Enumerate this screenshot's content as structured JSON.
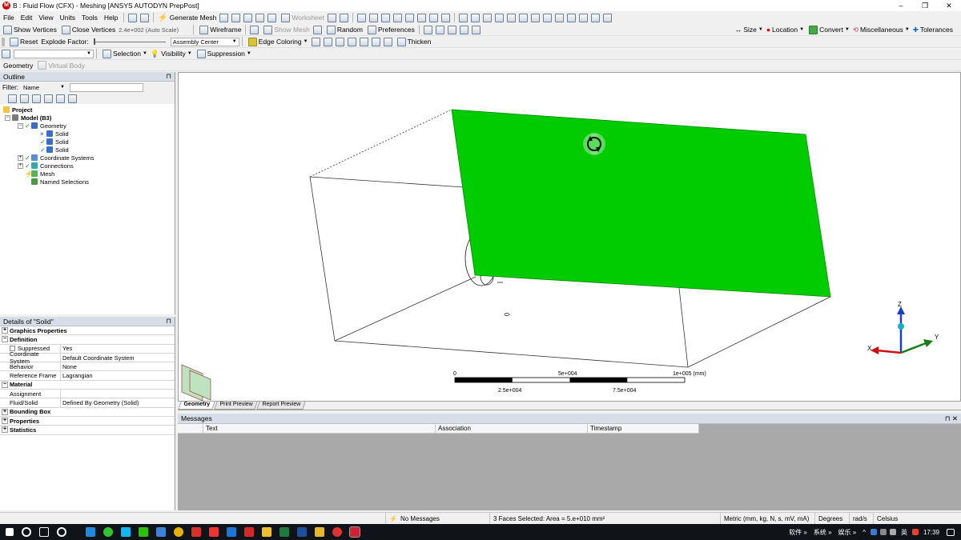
{
  "window": {
    "title": "B : Fluid Flow (CFX) - Meshing [ANSYS AUTODYN PrepPost]",
    "minimize": "–",
    "maximize": "❐",
    "close": "✕"
  },
  "menu": [
    "File",
    "Edit",
    "View",
    "Units",
    "Tools",
    "Help"
  ],
  "toolbar1": {
    "generate_mesh": "Generate Mesh",
    "show_mesh": "Show Mesh",
    "worksheet": "Worksheet"
  },
  "toolbar2": {
    "show_vertices": "Show Vertices",
    "close_vertices": "Close Vertices",
    "scale": "2.4e+002 (Auto Scale)",
    "wireframe": "Wireframe",
    "show_mesh": "Show Mesh",
    "random": "Random",
    "preferences": "Preferences",
    "size": "Size",
    "location": "Location",
    "convert": "Convert",
    "miscellaneous": "Miscellaneous",
    "tolerances": "Tolerances"
  },
  "toolbar3": {
    "reset": "Reset",
    "explode_factor": "Explode Factor:",
    "assembly_center": "Assembly Center",
    "edge_coloring": "Edge Coloring",
    "thicken": "Thicken"
  },
  "toolbar4": {
    "selection": "Selection",
    "visibility": "Visibility",
    "suppression": "Suppression"
  },
  "toolbar5": {
    "geometry": "Geometry",
    "virtual_body": "Virtual Body"
  },
  "outline": {
    "title": "Outline",
    "pin": "⊓",
    "filter_label": "Filter:",
    "filter_value": "Name",
    "tree": {
      "project": "Project",
      "model": "Model (B3)",
      "geometry": "Geometry",
      "solid1": "Solid",
      "solid2": "Solid",
      "solid3": "Solid",
      "coordinate_systems": "Coordinate Systems",
      "connections": "Connections",
      "mesh": "Mesh",
      "named_selections": "Named Selections"
    }
  },
  "details": {
    "title": "Details of \"Solid\"",
    "groups": {
      "graphics_properties": "Graphics Properties",
      "definition": "Definition",
      "material": "Material",
      "bounding_box": "Bounding Box",
      "properties": "Properties",
      "statistics": "Statistics"
    },
    "rows": {
      "suppressed_k": "Suppressed",
      "suppressed_v": "Yes",
      "coord_k": "Coordinate System",
      "coord_v": "Default Coordinate System",
      "behavior_k": "Behavior",
      "behavior_v": "None",
      "frame_k": "Reference Frame",
      "frame_v": "Lagrangian",
      "assignment_k": "Assignment",
      "assignment_v": "",
      "fluid_k": "Fluid/Solid",
      "fluid_v": "Defined By Geometry (Solid)"
    }
  },
  "viewport": {
    "scale_labels": [
      "0",
      "5e+004",
      "1e+005 (mm)",
      "2.5e+004",
      "7.5e+004"
    ],
    "axis_z": "Z",
    "axis_x": "X",
    "axis_y": "Y",
    "plane_color": "#00cc00"
  },
  "view_tabs": [
    "Geometry",
    "Print Preview",
    "Report Preview"
  ],
  "messages": {
    "title": "Messages",
    "pin": "⊓ ✕",
    "cols": [
      "Text",
      "Association",
      "Timestamp"
    ]
  },
  "status": {
    "no_messages": "No Messages",
    "selection": "3 Faces Selected: Area = 5.e+010 mm²",
    "units": "Metric (mm, kg, N, s, mV, mA)",
    "degrees": "Degrees",
    "rads": "rad/s",
    "celsius": "Celsius"
  },
  "taskbar": {
    "tray": [
      "软件 »",
      "系统 »",
      "娱乐 »",
      "英",
      "17:39"
    ]
  }
}
